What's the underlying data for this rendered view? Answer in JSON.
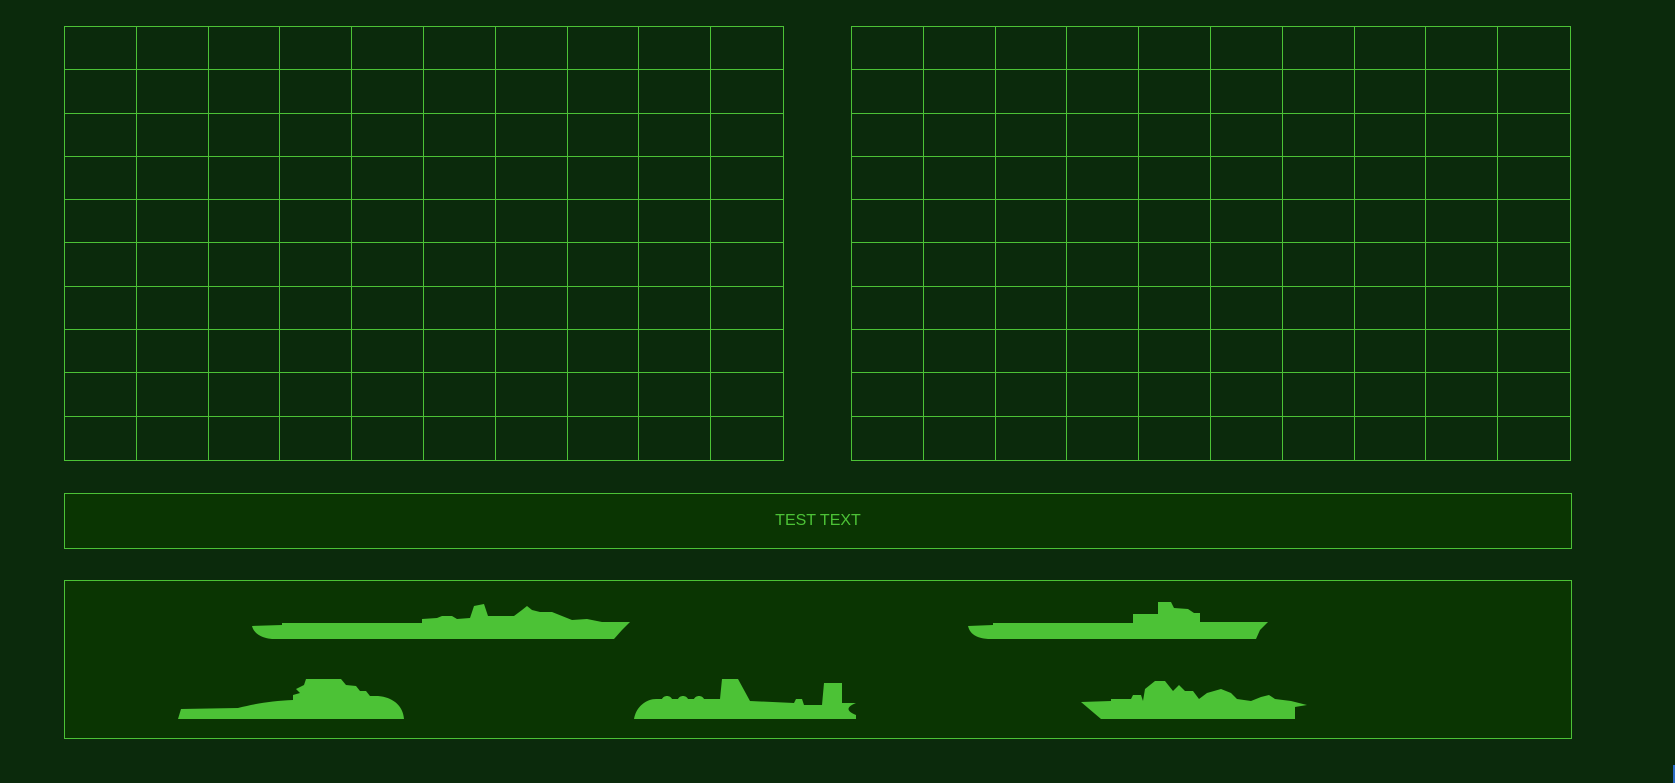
{
  "boards": {
    "player": {
      "rows": 10,
      "cols": 10
    },
    "enemy": {
      "rows": 10,
      "cols": 10
    }
  },
  "message": {
    "text": "TEST TEXT"
  },
  "fleet": {
    "ships": [
      {
        "name": "aircraft-carrier",
        "icon": "aircraft-carrier-icon"
      },
      {
        "name": "battleship",
        "icon": "battleship-icon"
      },
      {
        "name": "submarine",
        "icon": "submarine-icon"
      },
      {
        "name": "submarine-2",
        "icon": "submarine-icon"
      },
      {
        "name": "destroyer",
        "icon": "destroyer-icon"
      }
    ]
  },
  "colors": {
    "background": "#0b2a0c",
    "panel": "#0a3502",
    "accent": "#4cc236"
  }
}
